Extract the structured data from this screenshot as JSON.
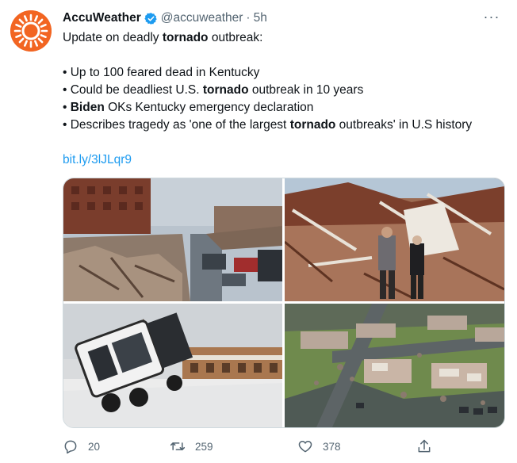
{
  "tweet": {
    "author_name": "AccuWeather",
    "handle": "@accuweather",
    "separator": "·",
    "time": "5h",
    "more_label": "···",
    "lines": [
      [
        {
          "t": "Update on deadly "
        },
        {
          "t": "tornado",
          "b": true
        },
        {
          "t": " outbreak:"
        }
      ],
      [],
      [
        {
          "t": "• Up to 100 feared dead in Kentucky"
        }
      ],
      [
        {
          "t": "• Could be deadliest U.S. "
        },
        {
          "t": "tornado",
          "b": true
        },
        {
          "t": " outbreak in 10 years"
        }
      ],
      [
        {
          "t": "• "
        },
        {
          "t": "Biden",
          "b": true
        },
        {
          "t": " OKs Kentucky emergency declaration"
        }
      ],
      [
        {
          "t": "• Describes tragedy as 'one of the largest "
        },
        {
          "t": "tornado",
          "b": true
        },
        {
          "t": " outbreaks' in U.S history"
        }
      ],
      []
    ],
    "link": "bit.ly/3lJLqr9"
  },
  "colors": {
    "brand_orange": "#f26522",
    "link_blue": "#1d9bf0",
    "verified_blue": "#1d9bf0",
    "muted": "#536471"
  },
  "media": [
    {
      "name": "photo-street-debris-icon"
    },
    {
      "name": "photo-collapsed-house-icon"
    },
    {
      "name": "photo-overturned-truck-icon"
    },
    {
      "name": "photo-aerial-damage-icon"
    }
  ],
  "actions": {
    "reply_count": "20",
    "retweet_count": "259",
    "like_count": "378",
    "reply_icon": "reply-icon",
    "retweet_icon": "retweet-icon",
    "like_icon": "heart-icon",
    "share_icon": "share-icon"
  }
}
